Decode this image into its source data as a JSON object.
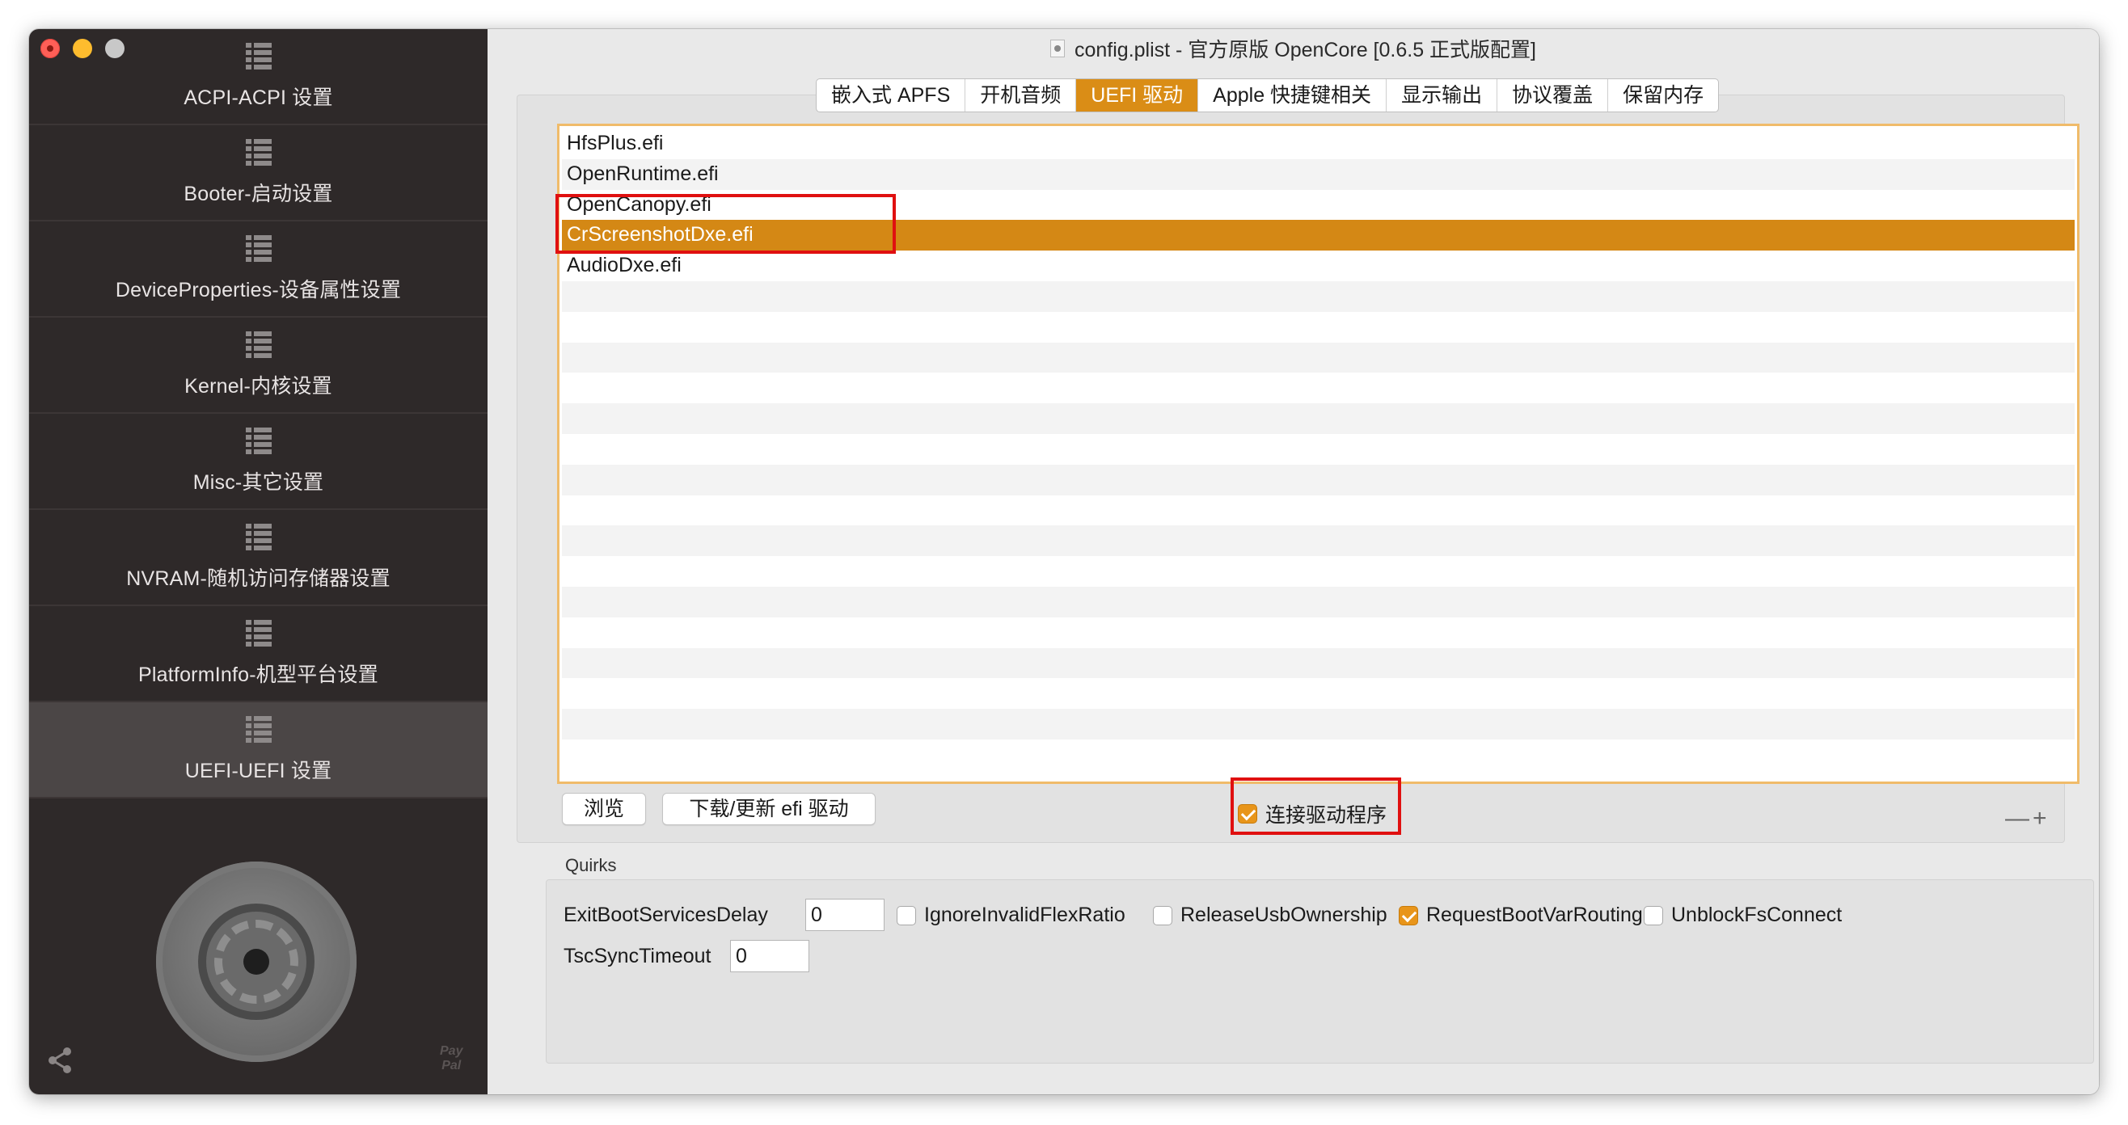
{
  "window": {
    "title": "config.plist - 官方原版 OpenCore [0.6.5 正式版配置]"
  },
  "sidebar": {
    "items": [
      {
        "label": "ACPI-ACPI 设置"
      },
      {
        "label": "Booter-启动设置"
      },
      {
        "label": "DeviceProperties-设备属性设置"
      },
      {
        "label": "Kernel-内核设置"
      },
      {
        "label": "Misc-其它设置"
      },
      {
        "label": "NVRAM-随机访问存储器设置"
      },
      {
        "label": "PlatformInfo-机型平台设置"
      },
      {
        "label": "UEFI-UEFI 设置",
        "active": true
      }
    ],
    "paypal_text": [
      "Pay",
      "Pal"
    ]
  },
  "tabs": [
    {
      "label": "嵌入式 APFS"
    },
    {
      "label": "开机音频"
    },
    {
      "label": "UEFI 驱动",
      "active": true
    },
    {
      "label": "Apple 快捷键相关"
    },
    {
      "label": "显示输出"
    },
    {
      "label": "协议覆盖"
    },
    {
      "label": "保留内存"
    }
  ],
  "drivers": {
    "rows": [
      {
        "name": "HfsPlus.efi"
      },
      {
        "name": "OpenRuntime.efi"
      },
      {
        "name": "OpenCanopy.efi"
      },
      {
        "name": "CrScreenshotDxe.efi",
        "selected": true
      },
      {
        "name": "AudioDxe.efi"
      }
    ],
    "browse_label": "浏览",
    "download_label": "下载/更新 efi 驱动",
    "connect_drivers_label": "连接驱动程序",
    "connect_drivers_checked": true,
    "remove_symbol": "—",
    "add_symbol": "+"
  },
  "quirks": {
    "section_label": "Quirks",
    "exit_boot_services_delay": {
      "label": "ExitBootServicesDelay",
      "value": "0"
    },
    "ignore_invalid_flex_ratio": {
      "label": "IgnoreInvalidFlexRatio",
      "checked": false
    },
    "release_usb_ownership": {
      "label": "ReleaseUsbOwnership",
      "checked": false
    },
    "request_boot_var_routing": {
      "label": "RequestBootVarRouting",
      "checked": true
    },
    "unblock_fs_connect": {
      "label": "UnblockFsConnect",
      "checked": false
    },
    "tsc_sync_timeout": {
      "label": "TscSyncTimeout",
      "value": "0"
    }
  },
  "colors": {
    "accent_orange": "#da8d16",
    "selection_orange": "#d48815",
    "highlight_red": "#e01010",
    "sidebar_bg": "#2e2929"
  }
}
